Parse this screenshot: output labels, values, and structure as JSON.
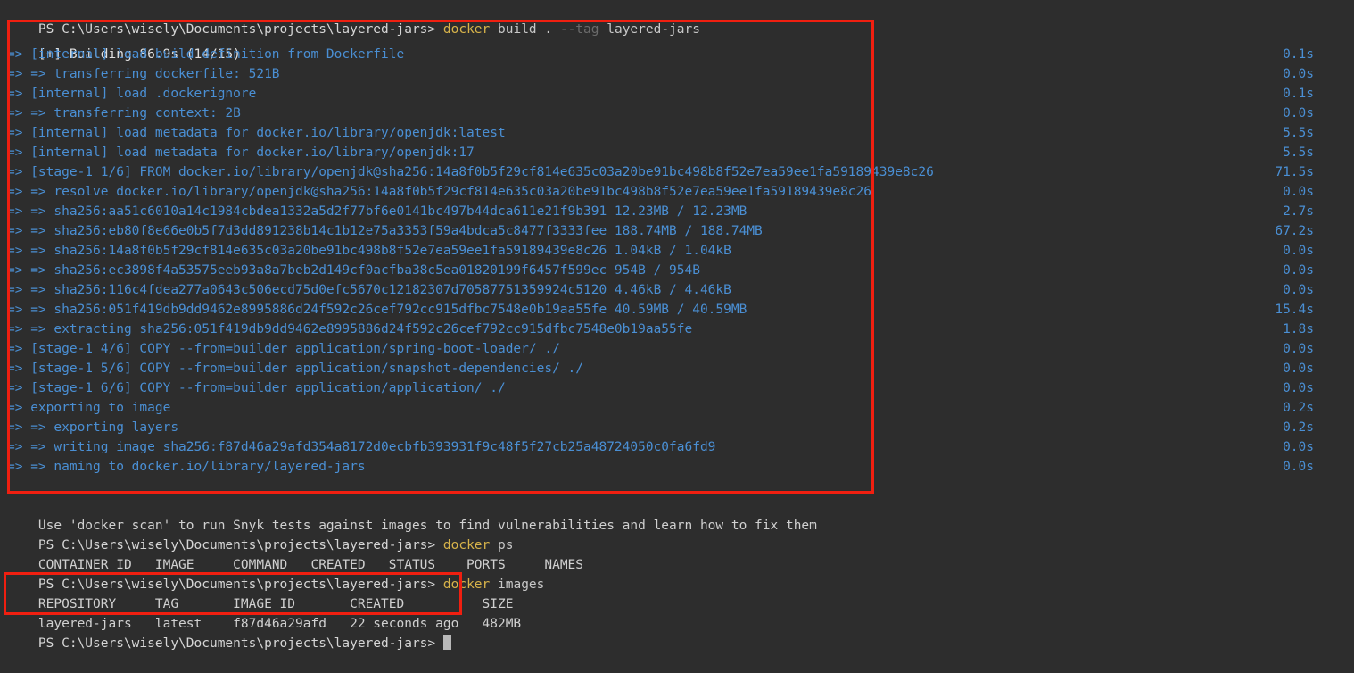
{
  "terminal": {
    "shell": "powershell",
    "colors": {
      "background": "#2d2d2d",
      "prompt_text": "#d6d6d6",
      "command_keyword": "#d7b34a",
      "build_output": "#4a8fd4",
      "annotation_box": "#f01f10",
      "cursor": "#b8b8b8"
    },
    "prompt": "PS C:\\Users\\wisely\\Documents\\projects\\layered-jars>"
  },
  "commands": {
    "build": {
      "command_keyword": "docker",
      "args": "build .",
      "flag": "--tag",
      "flag_value": "layered-jars"
    },
    "ps": {
      "command_keyword": "docker",
      "args": "ps"
    },
    "images": {
      "command_keyword": "docker",
      "args": "images"
    }
  },
  "build_output": {
    "header": "[+] Building 86.9s (14/15)",
    "steps": [
      {
        "text": "=> [internal] load build definition from Dockerfile",
        "time": "0.1s"
      },
      {
        "text": "=> => transferring dockerfile: 521B",
        "time": "0.0s"
      },
      {
        "text": "=> [internal] load .dockerignore",
        "time": "0.1s"
      },
      {
        "text": "=> => transferring context: 2B",
        "time": "0.0s"
      },
      {
        "text": "=> [internal] load metadata for docker.io/library/openjdk:latest",
        "time": "5.5s"
      },
      {
        "text": "=> [internal] load metadata for docker.io/library/openjdk:17",
        "time": "5.5s"
      },
      {
        "text": "=> [stage-1 1/6] FROM docker.io/library/openjdk@sha256:14a8f0b5f29cf814e635c03a20be91bc498b8f52e7ea59ee1fa59189439e8c26",
        "time": "71.5s"
      },
      {
        "text": "=> => resolve docker.io/library/openjdk@sha256:14a8f0b5f29cf814e635c03a20be91bc498b8f52e7ea59ee1fa59189439e8c26",
        "time": "0.0s"
      },
      {
        "text": "=> => sha256:aa51c6010a14c1984cbdea1332a5d2f77bf6e0141bc497b44dca611e21f9b391 12.23MB / 12.23MB",
        "time": "2.7s"
      },
      {
        "text": "=> => sha256:eb80f8e66e0b5f7d3dd891238b14c1b12e75a3353f59a4bdca5c8477f3333fee 188.74MB / 188.74MB",
        "time": "67.2s"
      },
      {
        "text": "=> => sha256:14a8f0b5f29cf814e635c03a20be91bc498b8f52e7ea59ee1fa59189439e8c26 1.04kB / 1.04kB",
        "time": "0.0s"
      },
      {
        "text": "=> => sha256:ec3898f4a53575eeb93a8a7beb2d149cf0acfba38c5ea01820199f6457f599ec 954B / 954B",
        "time": "0.0s"
      },
      {
        "text": "=> => sha256:116c4fdea277a0643c506ecd75d0efc5670c12182307d70587751359924c5120 4.46kB / 4.46kB",
        "time": "0.0s"
      },
      {
        "text": "=> => sha256:051f419db9dd9462e8995886d24f592c26cef792cc915dfbc7548e0b19aa55fe 40.59MB / 40.59MB",
        "time": "15.4s"
      },
      {
        "text": "=> => extracting sha256:051f419db9dd9462e8995886d24f592c26cef792cc915dfbc7548e0b19aa55fe",
        "time": "1.8s"
      },
      {
        "text": "=> [stage-1 4/6] COPY --from=builder application/spring-boot-loader/ ./",
        "time": "0.0s"
      },
      {
        "text": "=> [stage-1 5/6] COPY --from=builder application/snapshot-dependencies/ ./",
        "time": "0.0s"
      },
      {
        "text": "=> [stage-1 6/6] COPY --from=builder application/application/ ./",
        "time": "0.0s"
      },
      {
        "text": "=> exporting to image",
        "time": "0.2s"
      },
      {
        "text": "=> => exporting layers",
        "time": "0.2s"
      },
      {
        "text": "=> => writing image sha256:f87d46a29afd354a8172d0ecbfb393931f9c48f5f27cb25a48724050c0fa6fd9",
        "time": "0.0s"
      },
      {
        "text": "=> => naming to docker.io/library/layered-jars",
        "time": "0.0s"
      }
    ],
    "scan_hint": "Use 'docker scan' to run Snyk tests against images to find vulnerabilities and learn how to fix them"
  },
  "ps_table": {
    "header": "CONTAINER ID   IMAGE     COMMAND   CREATED   STATUS    PORTS     NAMES",
    "rows": []
  },
  "images_table": {
    "header": "REPOSITORY     TAG       IMAGE ID       CREATED          SIZE",
    "rows": [
      "layered-jars   latest    f87d46a29afd   22 seconds ago   482MB"
    ]
  },
  "annotations": {
    "build_box_label": "build-output-highlight",
    "images_box_label": "images-table-highlight"
  }
}
